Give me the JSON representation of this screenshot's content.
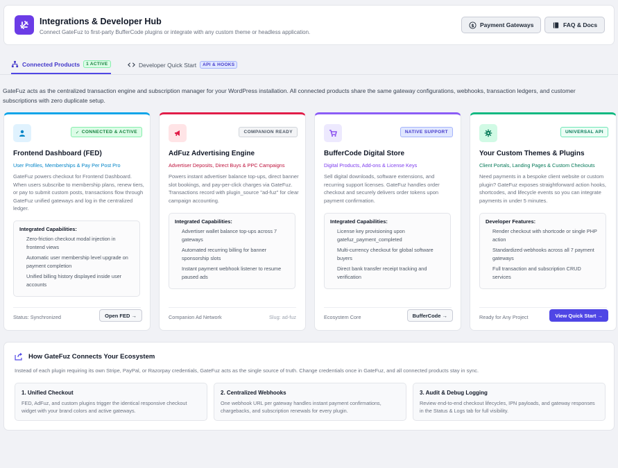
{
  "header": {
    "title": "Integrations & Developer Hub",
    "subtitle": "Connect GateFuz to first-party BufferCode plugins or integrate with any custom theme or headless application.",
    "payment_gateways_label": "Payment Gateways",
    "faq_label": "FAQ & Docs",
    "logo_icon": "plug-icon"
  },
  "tabs": {
    "connected_label": "Connected Products",
    "connected_badge": "1 ACTIVE",
    "developer_label": "Developer Quick Start",
    "developer_badge": "API & HOOKS"
  },
  "intro": "GateFuz acts as the centralized transaction engine and subscription manager for your WordPress installation. All connected products share the same gateway configurations, webhooks, transaction ledgers, and customer subscriptions with zero duplicate setup.",
  "cards": [
    {
      "accent": "#0ea5e9",
      "icon": "user-icon",
      "badge": "CONNECTED & ACTIVE",
      "title": "Frontend Dashboard (FED)",
      "subtitle": "User Profiles, Memberships & Pay Per Post Pro",
      "subtitle_color": "#0284c7",
      "description": "GateFuz powers checkout for Frontend Dashboard. When users subscribe to membership plans, renew tiers, or pay to submit custom posts, transactions flow through GateFuz unified gateways and log in the centralized ledger.",
      "box_title": "Integrated Capabilities:",
      "items": [
        "Zero-friction checkout modal injection in frontend views",
        "Automatic user membership level upgrade on payment completion",
        "Unified billing history displayed inside user accounts"
      ],
      "footer": "Status: Synchronized",
      "button": "Open FED →"
    },
    {
      "accent": "#e11d48",
      "icon": "megaphone-icon",
      "badge": "COMPANION READY",
      "title": "AdFuz Advertising Engine",
      "subtitle": "Advertiser Deposits, Direct Buys & PPC Campaigns",
      "subtitle_color": "#be123c",
      "description": "Powers instant advertiser balance top-ups, direct banner slot bookings, and pay-per-click charges via GateFuz. Transactions record with plugin_source \"ad-fuz\" for clear campaign accounting.",
      "box_title": "Integrated Capabilities:",
      "items": [
        "Advertiser wallet balance top-ups across 7 gateways",
        "Automated recurring billing for banner sponsorship slots",
        "Instant payment webhook listener to resume paused ads"
      ],
      "footer": "Companion Ad Network",
      "footer_right": "Slug: ad-fuz"
    },
    {
      "accent": "#8b5cf6",
      "icon": "cart-icon",
      "badge": "NATIVE SUPPORT",
      "title": "BufferCode Digital Store",
      "subtitle": "Digital Products, Add-ons & License Keys",
      "subtitle_color": "#7c3aed",
      "description": "Sell digital downloads, software extensions, and recurring support licenses. GateFuz handles order checkout and securely delivers order tokens upon payment confirmation.",
      "box_title": "Integrated Capabilities:",
      "items": [
        "License key provisioning upon gatefuz_payment_completed",
        "Multi-currency checkout for global software buyers",
        "Direct bank transfer receipt tracking and verification"
      ],
      "footer": "Ecosystem Core",
      "button": "BufferCode →"
    },
    {
      "accent": "#10b981",
      "icon": "gear-icon",
      "badge": "UNIVERSAL API",
      "title": "Your Custom Themes & Plugins",
      "subtitle": "Client Portals, Landing Pages & Custom Checkouts",
      "subtitle_color": "#047857",
      "description": "Need payments in a bespoke client website or custom plugin? GateFuz exposes straightforward action hooks, shortcodes, and lifecycle events so you can integrate payments in under 5 minutes.",
      "box_title": "Developer Features:",
      "items": [
        "Render checkout with shortcode or single PHP action",
        "Standardized webhooks across all 7 payment gateways",
        "Full transaction and subscription CRUD services"
      ],
      "footer": "Ready for Any Project",
      "button": "View Quick Start →"
    }
  ],
  "ecosystem": {
    "title": "How GateFuz Connects Your Ecosystem",
    "description": "Instead of each plugin requiring its own Stripe, PayPal, or Razorpay credentials, GateFuz acts as the single source of truth. Change credentials once in GateFuz, and all connected products stay in sync.",
    "steps": [
      {
        "title": "1. Unified Checkout",
        "text": "FED, AdFuz, and custom plugins trigger the identical responsive checkout widget with your brand colors and active gateways."
      },
      {
        "title": "2. Centralized Webhooks",
        "text": "One webhook URL per gateway handles instant payment confirmations, chargebacks, and subscription renewals for every plugin."
      },
      {
        "title": "3. Audit & Debug Logging",
        "text": "Review end-to-end checkout lifecycles, IPN payloads, and gateway responses in the Status & Logs tab for full visibility."
      }
    ]
  }
}
